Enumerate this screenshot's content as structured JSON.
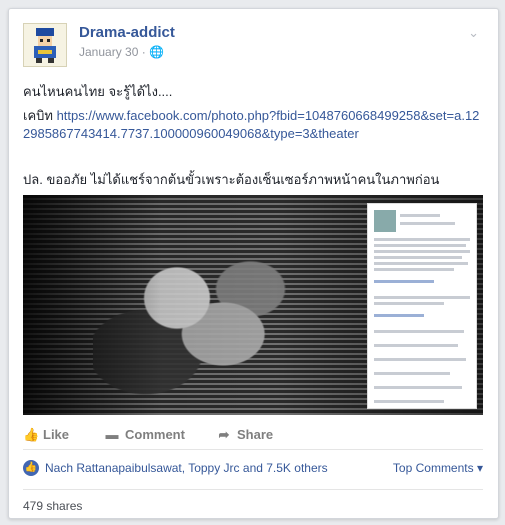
{
  "post": {
    "author": "Drama-addict",
    "date": "January 30 · ",
    "audience_icon": "globe-icon",
    "text_line1": "คนไหนคนไทย จะรู้ได้ไง....",
    "credit_prefix": "เคบิท ",
    "credit_link": "https://www.facebook.com/photo.php?fbid=1048760668499258&set=a.122985867743414.7737.100000960049068&type=3&theater",
    "text_line3": "ปล. ขออภัย ไม่ได้แชร์จากต้นขั้วเพราะต้องเซ็นเซอร์ภาพหน้าคนในภาพก่อน"
  },
  "actions": {
    "like": "Like",
    "comment": "Comment",
    "share": "Share"
  },
  "reactions": {
    "likers": "Nach Rattanapaibulsawat, Toppy Jrc and 7.5K others",
    "top_comments": "Top Comments"
  },
  "shares": "479 shares",
  "colors": {
    "link": "#365899",
    "like_badge": "#4267b2"
  }
}
